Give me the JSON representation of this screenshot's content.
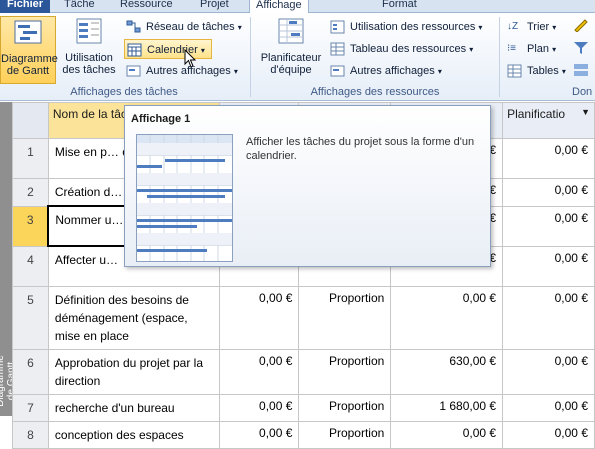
{
  "tabs": [
    {
      "label": "Fichier"
    },
    {
      "label": "Tâche"
    },
    {
      "label": "Ressource"
    },
    {
      "label": "Projet"
    },
    {
      "label": "Affichage"
    },
    {
      "label": "Format"
    }
  ],
  "ribbon": {
    "gantt_label": "Diagramme de Gantt",
    "task_usage_label": "Utilisation des tâches",
    "network_label": "Réseau de tâches",
    "calendar_label": "Calendrier",
    "other_views_label": "Autres affichages",
    "task_views_group": "Affichages des tâches",
    "team_planner_label": "Planificateur d'équipe",
    "resource_usage_label": "Utilisation des ressources",
    "resource_sheet_label": "Tableau des ressources",
    "other_views2_label": "Autres affichages",
    "resource_views_group": "Affichages des ressources",
    "sort_label": "Trier",
    "outline_label": "Plan",
    "tables_label": "Tables",
    "data_group": "Don"
  },
  "tooltip": {
    "title": "Affichage 1",
    "description": "Afficher les tâches du projet sous la forme d'un calendrier."
  },
  "sidebar_label": "Diagramme de Gantt",
  "table": {
    "headers": {
      "name": "Nom de la tâche",
      "planning": "Planificatio"
    },
    "rows": [
      {
        "id": "1",
        "name": "Mise en p… organisati…",
        "cost": "",
        "planning_type": "",
        "amount": "€",
        "planning": "0,00 €"
      },
      {
        "id": "2",
        "name": "Création d…",
        "cost": "",
        "planning_type": "",
        "amount": "€",
        "planning": "0,00 €"
      },
      {
        "id": "3",
        "name": "Nommer u… coordonn…",
        "cost": "",
        "planning_type": "",
        "amount": "€",
        "planning": "0,00 €"
      },
      {
        "id": "4",
        "name": "Affecter u…",
        "cost": "",
        "planning_type": "",
        "amount": "€",
        "planning": "0,00 €"
      },
      {
        "id": "5",
        "name": "Définition des besoins de déménagement (espace, mise en place",
        "cost": "0,00 €",
        "planning_type": "Proportion",
        "amount": "0,00 €",
        "planning": "0,00 €"
      },
      {
        "id": "6",
        "name": "Approbation du projet par la direction",
        "cost": "0,00 €",
        "planning_type": "Proportion",
        "amount": "630,00 €",
        "planning": "0,00 €"
      },
      {
        "id": "7",
        "name": "recherche d'un bureau",
        "cost": "0,00 €",
        "planning_type": "Proportion",
        "amount": "1 680,00 €",
        "planning": "0,00 €"
      },
      {
        "id": "8",
        "name": "conception des espaces",
        "cost": "0,00 €",
        "planning_type": "Proportion",
        "amount": "0,00 €",
        "planning": "0,00 €"
      }
    ]
  }
}
